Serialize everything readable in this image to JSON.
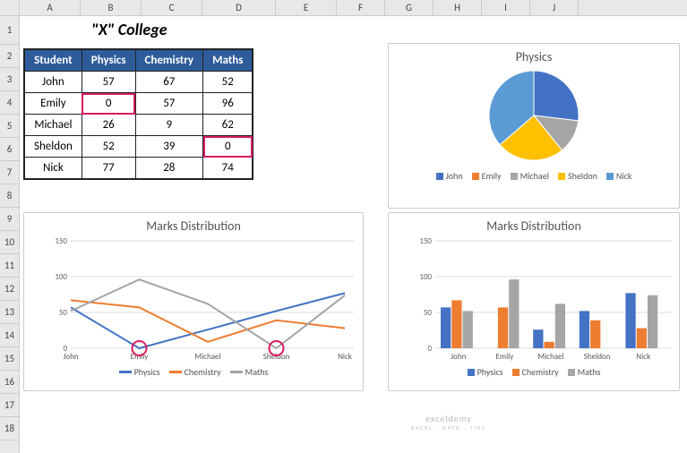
{
  "title": "\"X\" College",
  "columns": [
    "A",
    "B",
    "C",
    "D",
    "E",
    "F",
    "G",
    "H",
    "I",
    "J"
  ],
  "rows": [
    "1",
    "2",
    "3",
    "4",
    "5",
    "6",
    "7",
    "8",
    "9",
    "10",
    "11",
    "12",
    "13",
    "14",
    "15",
    "16",
    "17",
    "18"
  ],
  "table": {
    "headers": [
      "Student",
      "Physics",
      "Chemistry",
      "Maths"
    ],
    "data": [
      {
        "student": "John",
        "physics": 57,
        "chemistry": 67,
        "maths": 52,
        "hl": []
      },
      {
        "student": "Emily",
        "physics": 0,
        "chemistry": 57,
        "maths": 96,
        "hl": [
          "physics"
        ]
      },
      {
        "student": "Michael",
        "physics": 26,
        "chemistry": 9,
        "maths": 62,
        "hl": []
      },
      {
        "student": "Sheldon",
        "physics": 52,
        "chemistry": 39,
        "maths": 0,
        "hl": [
          "maths"
        ]
      },
      {
        "student": "Nick",
        "physics": 77,
        "chemistry": 28,
        "maths": 74,
        "hl": []
      }
    ]
  },
  "colors": {
    "physics": "#4472c4",
    "chemistry": "#ed7d31",
    "maths": "#a5a5a5",
    "john": "#4472c4",
    "emily": "#ed7d31",
    "michael": "#a5a5a5",
    "sheldon": "#ffc000",
    "nick": "#5b9bd5"
  },
  "pie": {
    "title": "Physics",
    "legend": [
      "John",
      "Emily",
      "Michael",
      "Sheldon",
      "Nick"
    ]
  },
  "line": {
    "title": "Marks Distribution",
    "ylabels": [
      "150",
      "100",
      "50",
      "0"
    ],
    "series": [
      "Physics",
      "Chemistry",
      "Maths"
    ]
  },
  "bar": {
    "title": "Marks Distribution",
    "ylabels": [
      "150",
      "100",
      "50",
      "0"
    ],
    "series": [
      "Physics",
      "Chemistry",
      "Maths"
    ]
  },
  "watermark": {
    "main": "exceldemy",
    "sub": "EXCEL · DATA · TIPS"
  },
  "chart_data": [
    {
      "type": "pie",
      "title": "Physics",
      "categories": [
        "John",
        "Emily",
        "Michael",
        "Sheldon",
        "Nick"
      ],
      "values": [
        57,
        0,
        26,
        52,
        77
      ]
    },
    {
      "type": "line",
      "title": "Marks Distribution",
      "categories": [
        "John",
        "Emily",
        "Michael",
        "Sheldon",
        "Nick"
      ],
      "series": [
        {
          "name": "Physics",
          "values": [
            57,
            0,
            26,
            52,
            77
          ]
        },
        {
          "name": "Chemistry",
          "values": [
            67,
            57,
            9,
            39,
            28
          ]
        },
        {
          "name": "Maths",
          "values": [
            52,
            96,
            62,
            0,
            74
          ]
        }
      ],
      "ylim": [
        0,
        150
      ],
      "xlabel": "",
      "ylabel": ""
    },
    {
      "type": "bar",
      "title": "Marks Distribution",
      "categories": [
        "John",
        "Emily",
        "Michael",
        "Sheldon",
        "Nick"
      ],
      "series": [
        {
          "name": "Physics",
          "values": [
            57,
            0,
            26,
            52,
            77
          ]
        },
        {
          "name": "Chemistry",
          "values": [
            67,
            57,
            9,
            39,
            28
          ]
        },
        {
          "name": "Maths",
          "values": [
            52,
            96,
            62,
            0,
            74
          ]
        }
      ],
      "ylim": [
        0,
        150
      ],
      "xlabel": "",
      "ylabel": ""
    }
  ]
}
